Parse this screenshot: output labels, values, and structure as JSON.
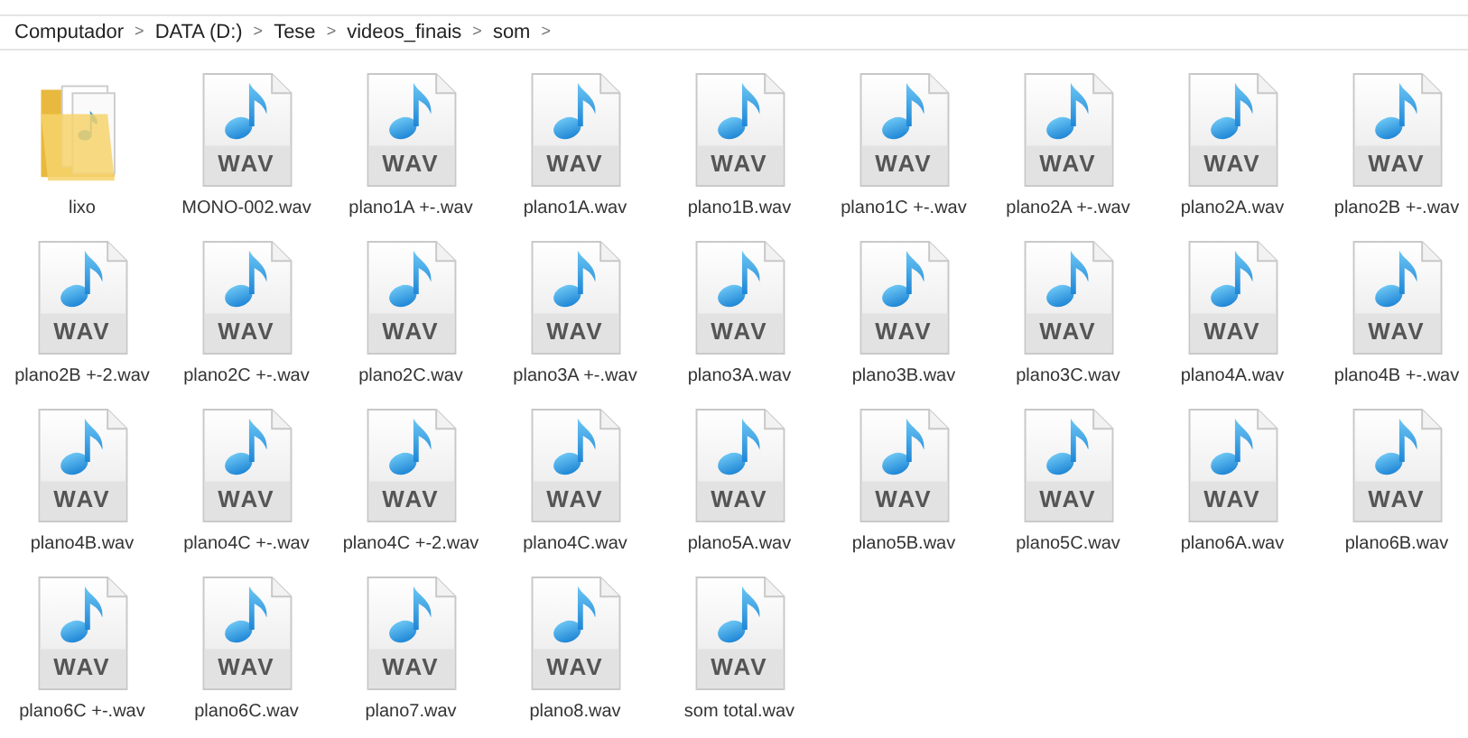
{
  "breadcrumb": [
    "Computador",
    "DATA (D:)",
    "Tese",
    "videos_finais",
    "som"
  ],
  "separator": ">",
  "files": [
    {
      "kind": "folder",
      "name": "lixo"
    },
    {
      "kind": "wav",
      "name": "MONO-002.wav",
      "badge": "WAV"
    },
    {
      "kind": "wav",
      "name": "plano1A +-.wav",
      "badge": "WAV"
    },
    {
      "kind": "wav",
      "name": "plano1A.wav",
      "badge": "WAV"
    },
    {
      "kind": "wav",
      "name": "plano1B.wav",
      "badge": "WAV"
    },
    {
      "kind": "wav",
      "name": "plano1C +-.wav",
      "badge": "WAV"
    },
    {
      "kind": "wav",
      "name": "plano2A +-.wav",
      "badge": "WAV"
    },
    {
      "kind": "wav",
      "name": "plano2A.wav",
      "badge": "WAV"
    },
    {
      "kind": "wav",
      "name": "plano2B +-.wav",
      "badge": "WAV"
    },
    {
      "kind": "wav",
      "name": "plano2B +-2.wav",
      "badge": "WAV"
    },
    {
      "kind": "wav",
      "name": "plano2C +-.wav",
      "badge": "WAV"
    },
    {
      "kind": "wav",
      "name": "plano2C.wav",
      "badge": "WAV"
    },
    {
      "kind": "wav",
      "name": "plano3A +-.wav",
      "badge": "WAV"
    },
    {
      "kind": "wav",
      "name": "plano3A.wav",
      "badge": "WAV"
    },
    {
      "kind": "wav",
      "name": "plano3B.wav",
      "badge": "WAV"
    },
    {
      "kind": "wav",
      "name": "plano3C.wav",
      "badge": "WAV"
    },
    {
      "kind": "wav",
      "name": "plano4A.wav",
      "badge": "WAV"
    },
    {
      "kind": "wav",
      "name": "plano4B +-.wav",
      "badge": "WAV"
    },
    {
      "kind": "wav",
      "name": "plano4B.wav",
      "badge": "WAV"
    },
    {
      "kind": "wav",
      "name": "plano4C +-.wav",
      "badge": "WAV"
    },
    {
      "kind": "wav",
      "name": "plano4C +-2.wav",
      "badge": "WAV"
    },
    {
      "kind": "wav",
      "name": "plano4C.wav",
      "badge": "WAV"
    },
    {
      "kind": "wav",
      "name": "plano5A.wav",
      "badge": "WAV"
    },
    {
      "kind": "wav",
      "name": "plano5B.wav",
      "badge": "WAV"
    },
    {
      "kind": "wav",
      "name": "plano5C.wav",
      "badge": "WAV"
    },
    {
      "kind": "wav",
      "name": "plano6A.wav",
      "badge": "WAV"
    },
    {
      "kind": "wav",
      "name": "plano6B.wav",
      "badge": "WAV"
    },
    {
      "kind": "wav",
      "name": "plano6C +-.wav",
      "badge": "WAV"
    },
    {
      "kind": "wav",
      "name": "plano6C.wav",
      "badge": "WAV"
    },
    {
      "kind": "wav",
      "name": "plano7.wav",
      "badge": "WAV"
    },
    {
      "kind": "wav",
      "name": "plano8.wav",
      "badge": "WAV"
    },
    {
      "kind": "wav",
      "name": "som total.wav",
      "badge": "WAV"
    }
  ]
}
